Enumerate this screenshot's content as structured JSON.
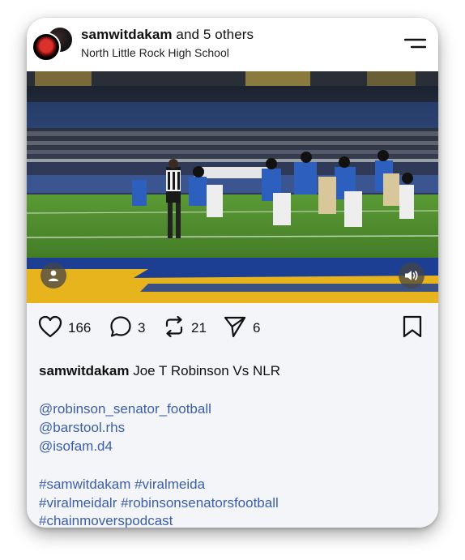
{
  "header": {
    "username": "samwitdakam",
    "others": " and 5 others",
    "location": "North Little Rock High School"
  },
  "icons": {
    "menu": "menu-icon",
    "user": "user-icon",
    "sound": "speaker-icon",
    "like": "heart-icon",
    "comment": "comment-icon",
    "repost": "repost-icon",
    "share": "send-icon",
    "save": "bookmark-icon"
  },
  "actions": {
    "likes": "166",
    "comments": "3",
    "reposts": "21",
    "shares": "6"
  },
  "caption": {
    "username": "samwitdakam",
    "text": " Joe T Robinson Vs NLR",
    "mentions": [
      "@robinson_senator_football",
      "@barstool.rhs",
      "@isofam.d4"
    ],
    "hashtag_lines": [
      "#samwitdakam #viralmeida",
      "#viralmeidalr #robinsonsenatorsfootball",
      "#chainmoverspodcast"
    ]
  },
  "colors": {
    "link": "#3b5eab",
    "action_bar_bg": "#f4f5f8",
    "field_green": "#4f8c2e",
    "endzone_blue": "#1c3f93",
    "endzone_gold": "#e8b41e"
  }
}
